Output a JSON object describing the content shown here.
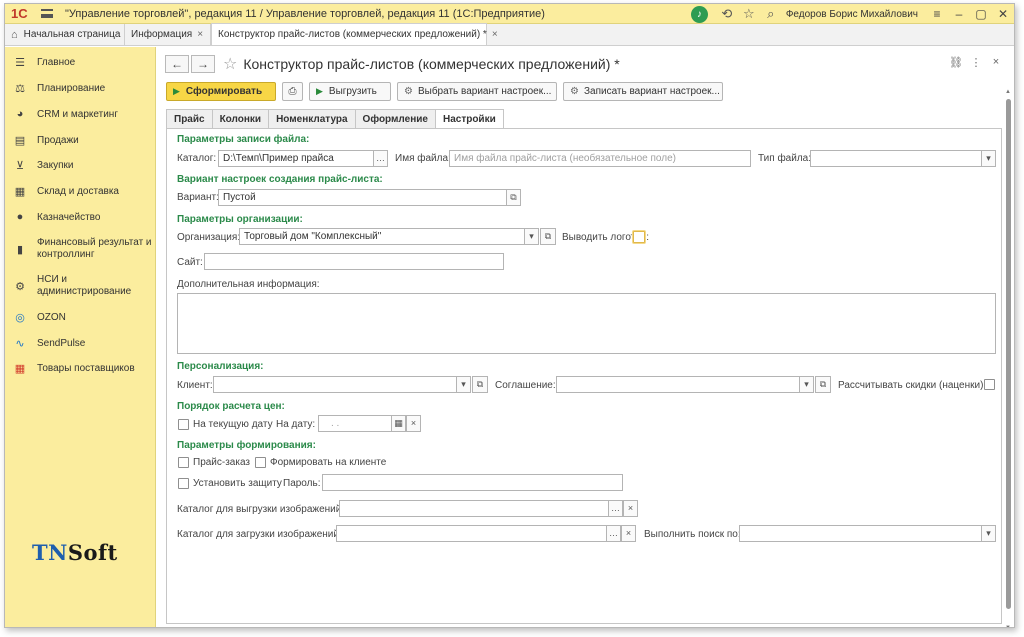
{
  "window": {
    "title": "\"Управление торговлей\", редакция 11 / Управление торговлей, редакция 11  (1С:Предприятие)",
    "user": "Федоров Борис Михайлович"
  },
  "tabs": [
    {
      "label": "Начальная страница"
    },
    {
      "label": "Информация"
    },
    {
      "label": "Конструктор прайс-листов (коммерческих предложений) *"
    }
  ],
  "sidebar": {
    "items": [
      {
        "label": "Главное",
        "icon": "list-icon"
      },
      {
        "label": "Планирование",
        "icon": "planning-icon"
      },
      {
        "label": "CRM и маркетинг",
        "icon": "crm-icon"
      },
      {
        "label": "Продажи",
        "icon": "sales-icon"
      },
      {
        "label": "Закупки",
        "icon": "cart-icon"
      },
      {
        "label": "Склад и доставка",
        "icon": "warehouse-icon"
      },
      {
        "label": "Казначейство",
        "icon": "treasury-icon"
      },
      {
        "label": "Финансовый результат и контроллинг",
        "icon": "chart-icon"
      },
      {
        "label": "НСИ и администрирование",
        "icon": "gear-icon"
      },
      {
        "label": "OZON",
        "icon": "ozon-icon"
      },
      {
        "label": "SendPulse",
        "icon": "sendpulse-icon"
      },
      {
        "label": "Товары поставщиков",
        "icon": "goods-icon"
      }
    ],
    "logo": {
      "part1": "TN",
      "part2": "Soft"
    }
  },
  "form": {
    "title": "Конструктор прайс-листов (коммерческих предложений) *",
    "toolbar": {
      "generate": "Сформировать",
      "export": "Выгрузить",
      "choose_variant": "Выбрать вариант настроек...",
      "save_variant": "Записать вариант настроек..."
    },
    "tabs": [
      "Прайс",
      "Колонки",
      "Номенклатура",
      "Оформление",
      "Настройки"
    ],
    "sections": {
      "file_params": "Параметры записи файла:",
      "variant": "Вариант настроек создания прайс-листа:",
      "org_params": "Параметры организации:",
      "personalization": "Персонализация:",
      "price_order": "Порядок расчета цен:",
      "gen_params": "Параметры формирования:"
    },
    "fields": {
      "catalog_label": "Каталог:",
      "catalog_value": "D:\\Темп\\Пример прайса",
      "filename_label": "Имя файла:",
      "filename_placeholder": "Имя файла прайс-листа (необязательное поле)",
      "filetype_label": "Тип файла:",
      "variant_label": "Вариант:",
      "variant_value": "Пустой",
      "org_label": "Организация:",
      "org_value": "Торговый дом \"Комплексный\"",
      "logo_label": "Выводить логотип:",
      "site_label": "Сайт:",
      "addinfo_label": "Дополнительная информация:",
      "client_label": "Клиент:",
      "agreement_label": "Соглашение:",
      "discount_label": "Рассчитывать скидки (наценки):",
      "current_date_label": "На текущую дату",
      "on_date_label": "На дату:",
      "date_placeholder": ".   .",
      "price_order_label": "Прайс-заказ",
      "client_gen_label": "Формировать на клиенте",
      "protect_label": "Установить защиту",
      "password_label": "Пароль:",
      "img_export_label": "Каталог для выгрузки изображений:",
      "img_import_label": "Каталог для загрузки изображений:",
      "search_label": "Выполнить поиск по:"
    }
  },
  "colors": {
    "sidebar_bg": "#fbed9e",
    "section_green": "#2b8a4a",
    "primary_button": "#f7d646"
  }
}
